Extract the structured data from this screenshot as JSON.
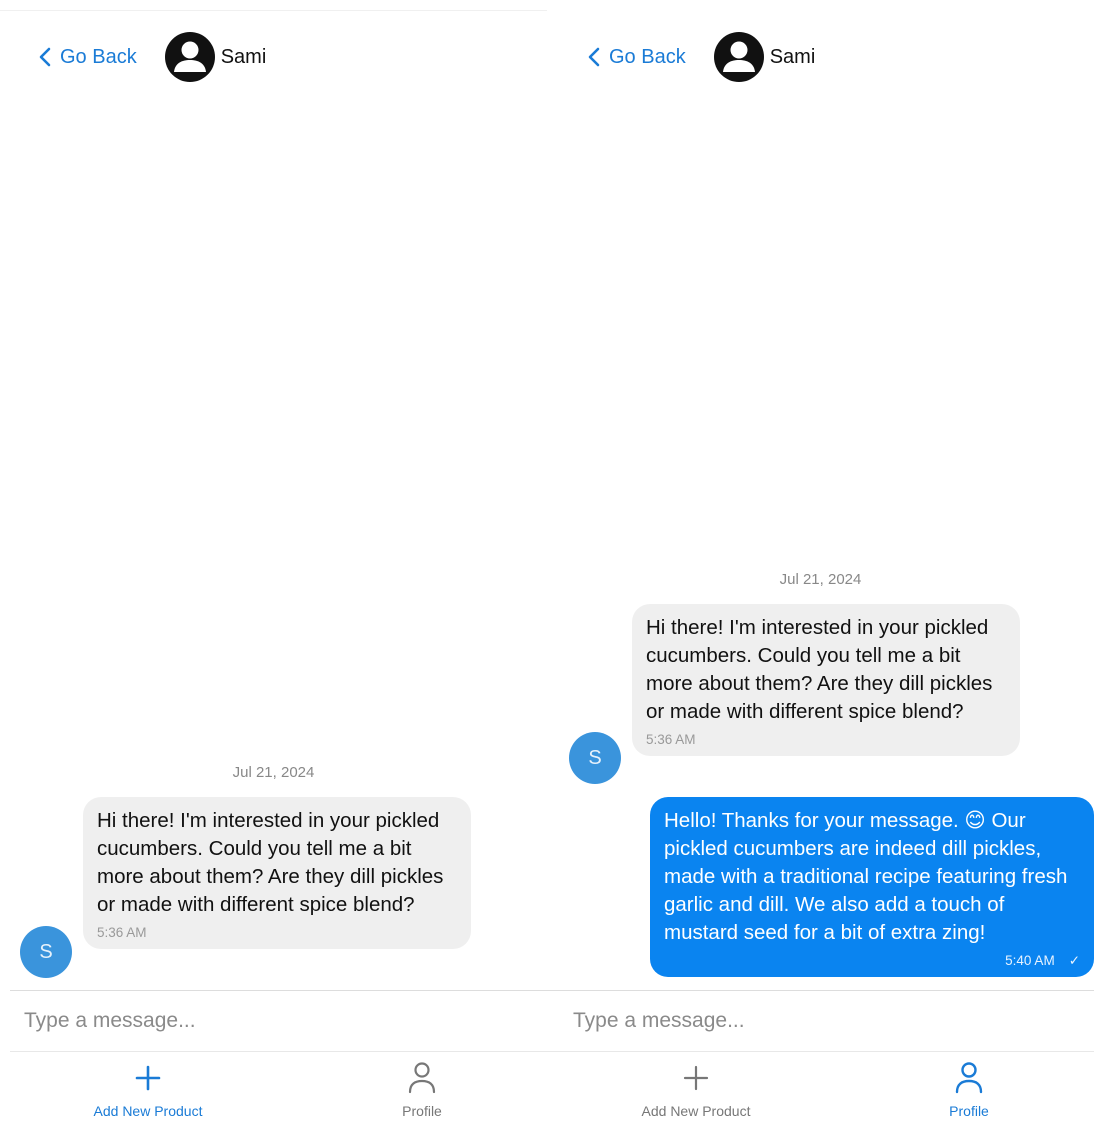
{
  "colors": {
    "accent": "#1a7bd6",
    "outgoing_bubble": "#0a84f0",
    "incoming_bubble": "#efefef",
    "avatar_bg": "#3a94dc"
  },
  "screens": [
    {
      "header": {
        "back_label": "Go Back",
        "contact_name": "Sami"
      },
      "date_label": "Jul 21, 2024",
      "messages": [
        {
          "direction": "in",
          "avatar_initial": "S",
          "text": "Hi there! I'm interested in your pickled cucumbers. Could you tell me a bit more about them? Are they dill pickles or made with different spice blend?",
          "time": "5:36 AM"
        }
      ],
      "composer": {
        "placeholder": "Type a message..."
      },
      "tabs": [
        {
          "label": "Add New Product",
          "icon": "plus-icon",
          "active": true
        },
        {
          "label": "Profile",
          "icon": "person-icon",
          "active": false
        }
      ]
    },
    {
      "header": {
        "back_label": "Go Back",
        "contact_name": "Sami"
      },
      "date_label": "Jul 21, 2024",
      "messages": [
        {
          "direction": "in",
          "avatar_initial": "S",
          "text": "Hi there! I'm interested in your pickled cucumbers. Could you tell me a bit more about them? Are they dill pickles or made with different spice blend?",
          "time": "5:36 AM"
        },
        {
          "direction": "out",
          "text": "Hello! Thanks for your message. 😊 Our pickled cucumbers are indeed dill pickles, made with a traditional recipe featuring fresh garlic and dill. We also add a touch of mustard seed for a bit of extra zing!",
          "time": "5:40 AM",
          "status": "✓"
        }
      ],
      "composer": {
        "placeholder": "Type a message..."
      },
      "tabs": [
        {
          "label": "Add New Product",
          "icon": "plus-icon",
          "active": false
        },
        {
          "label": "Profile",
          "icon": "person-icon",
          "active": true
        }
      ]
    }
  ]
}
